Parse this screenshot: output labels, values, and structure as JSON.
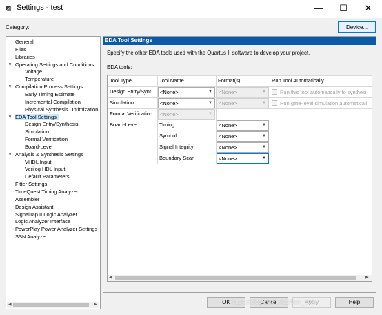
{
  "window": {
    "title": "Settings - test",
    "minimize_glyph": "—",
    "maximize_glyph": "☐",
    "close_glyph": "✕"
  },
  "category_label": "Category:",
  "device_button": "Device...",
  "tree": {
    "items": [
      {
        "label": "General",
        "indent": 0
      },
      {
        "label": "Files",
        "indent": 0
      },
      {
        "label": "Libraries",
        "indent": 0
      },
      {
        "label": "Operating Settings and Conditions",
        "indent": 0,
        "toggle": "∨"
      },
      {
        "label": "Voltage",
        "indent": 1
      },
      {
        "label": "Temperature",
        "indent": 1
      },
      {
        "label": "Compilation Process Settings",
        "indent": 0,
        "toggle": "∨"
      },
      {
        "label": "Early Timing Estimate",
        "indent": 1
      },
      {
        "label": "Incremental Compilation",
        "indent": 1
      },
      {
        "label": "Physical Synthesis Optimization",
        "indent": 1
      },
      {
        "label": "EDA Tool Settings",
        "indent": 0,
        "toggle": "∨",
        "selected": true
      },
      {
        "label": "Design Entry/Synthesis",
        "indent": 1
      },
      {
        "label": "Simulation",
        "indent": 1
      },
      {
        "label": "Formal Verification",
        "indent": 1
      },
      {
        "label": "Board-Level",
        "indent": 1
      },
      {
        "label": "Analysis & Synthesis Settings",
        "indent": 0,
        "toggle": "∨"
      },
      {
        "label": "VHDL Input",
        "indent": 1
      },
      {
        "label": "Verilog HDL Input",
        "indent": 1
      },
      {
        "label": "Default Parameters",
        "indent": 1
      },
      {
        "label": "Fitter Settings",
        "indent": 0
      },
      {
        "label": "TimeQuest Timing Analyzer",
        "indent": 0
      },
      {
        "label": "Assembler",
        "indent": 0
      },
      {
        "label": "Design Assistant",
        "indent": 0
      },
      {
        "label": "SignalTap II Logic Analyzer",
        "indent": 0
      },
      {
        "label": "Logic Analyzer Interface",
        "indent": 0
      },
      {
        "label": "PowerPlay Power Analyzer Settings",
        "indent": 0
      },
      {
        "label": "SSN Analyzer",
        "indent": 0
      }
    ]
  },
  "panel": {
    "header": "EDA Tool Settings",
    "description": "Specify the other EDA tools used with the Quartus II software to develop your project.",
    "eda_label": "EDA tools:",
    "columns": [
      "Tool Type",
      "Tool Name",
      "Format(s)",
      "Run Tool Automatically"
    ],
    "rows": [
      {
        "type": "Design Entry/Synt...",
        "tool": "<None>",
        "format": "<None>",
        "format_disabled": true,
        "run": "Run this tool automatically to synthesi"
      },
      {
        "type": "Simulation",
        "tool": "<None>",
        "format": "<None>",
        "format_disabled": true,
        "run": "Run gate-level simulation automaticall"
      },
      {
        "type": "Formal Verification",
        "tool": "<None>",
        "tool_disabled": true
      },
      {
        "type": "Board-Level",
        "tool": "Timing",
        "format": "<None>"
      },
      {
        "type": "",
        "tool": "Symbol",
        "format": "<None>"
      },
      {
        "type": "",
        "tool": "Signal Integrity",
        "format": "<None>"
      },
      {
        "type": "",
        "tool": "Boundary Scan",
        "format": "<None>",
        "format_active": true
      }
    ]
  },
  "footer": {
    "ok": "OK",
    "cancel": "Cancel",
    "apply": "Apply",
    "help": "Help"
  },
  "watermark": "https://blog.csdn.net/Alan_cwh",
  "colors": {
    "panel_header_bg": "#0b5aa8",
    "selection_bg": "#cce8ff",
    "active_border": "#0078d7"
  }
}
